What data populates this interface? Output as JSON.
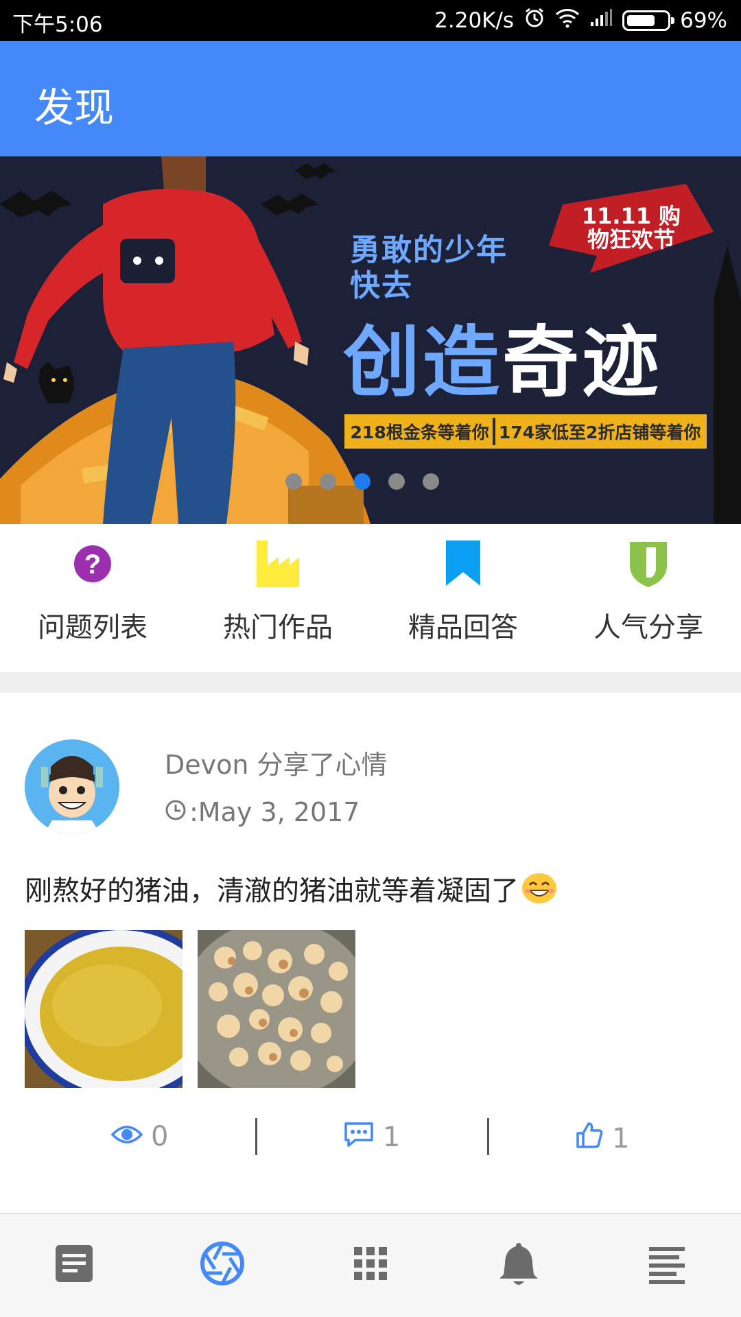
{
  "status_bar": {
    "time": "下午5:06",
    "speed": "2.20K/s",
    "battery": "69%",
    "battery_level": 0.69,
    "icons": [
      "alarm-icon",
      "wifi-icon",
      "signal-icon",
      "battery-icon"
    ]
  },
  "app_bar": {
    "title": "发现"
  },
  "banner": {
    "line1": "勇敢的少年",
    "line2": "快去",
    "line3_blue": "创造",
    "line3_white": "奇迹",
    "badge": "11.11 购物狂欢节",
    "promo_left": "218根金条等着你",
    "promo_right": "174家低至2折店铺等着你",
    "slides": 5,
    "active_slide": 3
  },
  "categories": [
    {
      "label": "问题列表",
      "icon": "question-icon",
      "color": "#9b2fb0"
    },
    {
      "label": "热门作品",
      "icon": "factory-icon",
      "color": "#ffeb3b"
    },
    {
      "label": "精品回答",
      "icon": "bookmark-icon",
      "color": "#0a9ff2"
    },
    {
      "label": "人气分享",
      "icon": "shield-icon",
      "color": "#8bc34a"
    }
  ],
  "post": {
    "author_line": "Devon 分享了心情",
    "date": ":May 3, 2017",
    "content": "刚熬好的猪油，清澈的猪油就等着凝固了",
    "views": "0",
    "comments": "1",
    "likes": "1"
  },
  "bottom_nav": {
    "items": [
      "article-icon",
      "camera-aperture-icon",
      "apps-grid-icon",
      "bell-icon",
      "menu-lines-icon"
    ],
    "active_index": 1,
    "active_color": "#4589f8",
    "inactive_color": "#6b6b6b"
  }
}
